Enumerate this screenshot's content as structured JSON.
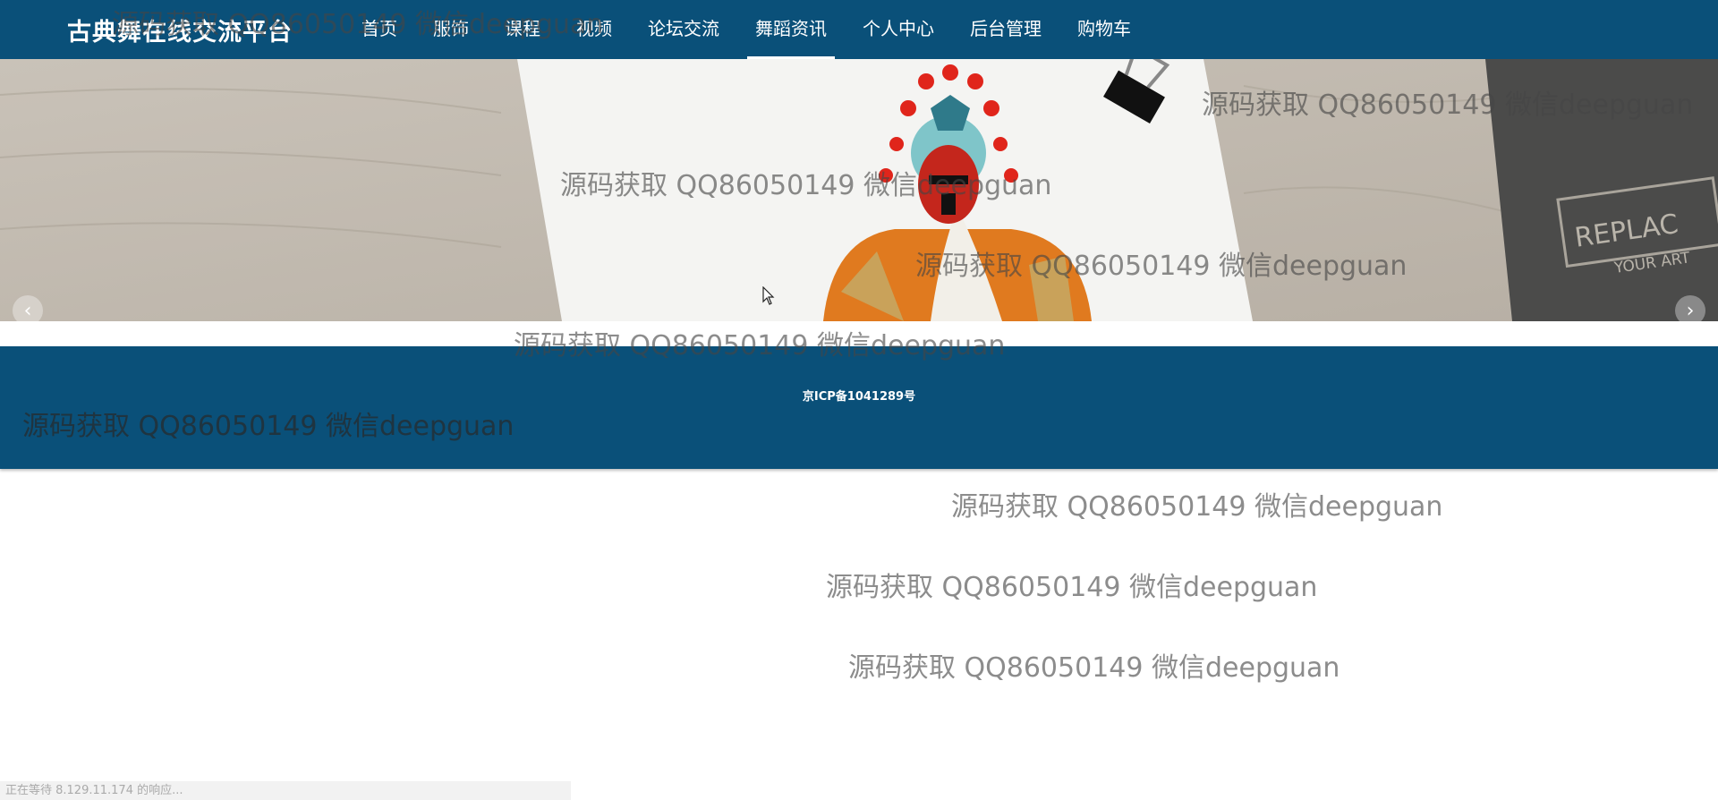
{
  "header": {
    "brand": "古典舞在线交流平台",
    "nav": [
      {
        "label": "首页",
        "active": false
      },
      {
        "label": "服饰",
        "active": false
      },
      {
        "label": "课程",
        "active": false
      },
      {
        "label": "视频",
        "active": false
      },
      {
        "label": "论坛交流",
        "active": false
      },
      {
        "label": "舞蹈资讯",
        "active": true
      },
      {
        "label": "个人中心",
        "active": false
      },
      {
        "label": "后台管理",
        "active": false
      },
      {
        "label": "购物车",
        "active": false
      }
    ]
  },
  "banner": {
    "prev_icon": "chevron-left-icon",
    "next_icon": "chevron-right-icon",
    "prev_glyph": "‹",
    "next_glyph": "›",
    "book_text_1": "REPLAC",
    "book_text_2": "YOUR ART"
  },
  "footer": {
    "icp": "京ICP备1041289号"
  },
  "watermark": "源码获取 QQ86050149 微信deepguan",
  "status_bar": "正在等待 8.129.11.174 的响应...",
  "colors": {
    "nav_bg": "#0a5079",
    "footer_bg": "#0a5079"
  }
}
